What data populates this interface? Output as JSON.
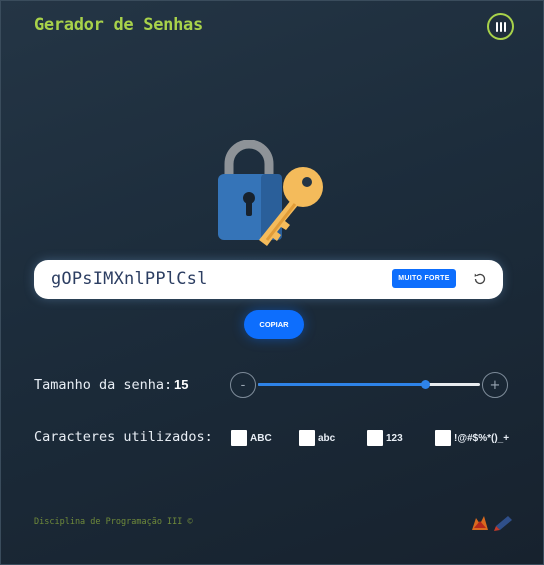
{
  "app": {
    "title": "Gerador de Senhas"
  },
  "password": {
    "value": "gOPsIMXnlPPlCsl",
    "strength": "MUITO FORTE",
    "copy_label": "COPIAR"
  },
  "size": {
    "label": "Tamanho da senha:",
    "value": "15",
    "level_fraction": 0.75,
    "minus_label": "-",
    "plus_label": "+"
  },
  "characters": {
    "label": "Caracteres utilizados:",
    "options": [
      {
        "label": "ABC",
        "checked": false
      },
      {
        "label": "abc",
        "checked": false
      },
      {
        "label": "123",
        "checked": false
      },
      {
        "label": "!@#$%*()_+",
        "checked": false
      }
    ]
  },
  "footer": {
    "text": "Disciplina de Programação III ©"
  },
  "icons": {
    "menu": "menu-icon",
    "lock_key": "lock-key-icon",
    "refresh": "refresh-icon",
    "footer_logos": "institution-logo-icon"
  },
  "colors": {
    "accent": "#a8d24a",
    "primary": "#0d6efd",
    "background": "#1f2e3c",
    "footer_text": "#6f8a3a"
  }
}
